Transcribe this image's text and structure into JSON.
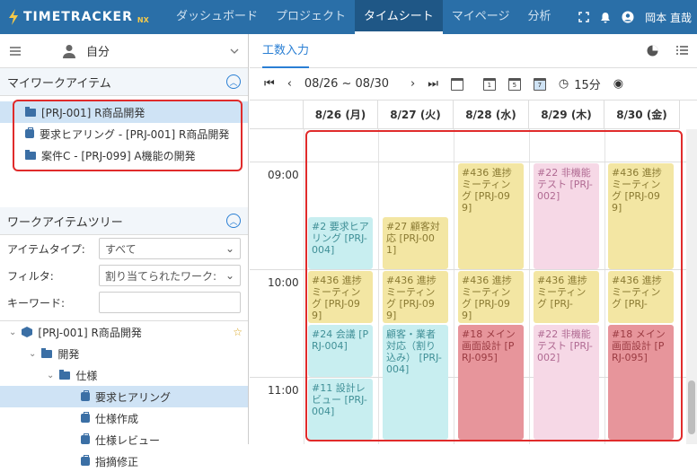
{
  "app": {
    "logo": "TIMETRACKER",
    "logo_suffix": "NX",
    "user": "岡本 直哉"
  },
  "nav": [
    {
      "label": "ダッシュボード"
    },
    {
      "label": "プロジェクト"
    },
    {
      "label": "タイムシート"
    },
    {
      "label": "マイページ"
    },
    {
      "label": "分析"
    }
  ],
  "left": {
    "who": "自分",
    "my_work_items_title": "マイワークアイテム",
    "my_work_items": [
      {
        "label": "[PRJ-001] R商品開発"
      },
      {
        "label": "要求ヒアリング - [PRJ-001] R商品開発"
      },
      {
        "label": "案件C - [PRJ-099] A機能の開発"
      }
    ],
    "tree_title": "ワークアイテムツリー",
    "item_type_label": "アイテムタイプ:",
    "item_type_value": "すべて",
    "filter_label": "フィルタ:",
    "filter_value": "割り当てられたワーク:",
    "keyword_label": "キーワード:",
    "keyword_value": "",
    "tree": [
      {
        "label": "[PRJ-001] R商品開発"
      },
      {
        "label": "開発"
      },
      {
        "label": "仕様"
      },
      {
        "label": "要求ヒアリング"
      },
      {
        "label": "仕様作成"
      },
      {
        "label": "仕様レビュー"
      },
      {
        "label": "指摘修正"
      }
    ]
  },
  "right": {
    "tab": "工数入力",
    "date_range": "08/26 ~ 08/30",
    "interval": "15分",
    "days": [
      "8/26 (月)",
      "8/27 (火)",
      "8/28 (水)",
      "8/29 (木)",
      "8/30 (金)"
    ],
    "times": [
      "09:00",
      "10:00",
      "11:00"
    ],
    "events": [
      {
        "text": "#436 進捗ミーティング [PRJ-099]",
        "color": "yellow"
      },
      {
        "text": "#22 非機能テスト [PRJ-002]",
        "color": "pink"
      },
      {
        "text": "#436 進捗ミーティング [PRJ-099]",
        "color": "yellow"
      },
      {
        "text": "#2 要求ヒアリング [PRJ-004]",
        "color": "cyan"
      },
      {
        "text": "#27 顧客対応 [PRJ-001]",
        "color": "yellow"
      },
      {
        "text": "#436 進捗ミーティング [PRJ-099]",
        "color": "yellow"
      },
      {
        "text": "#436 進捗ミーティング [PRJ-099]",
        "color": "yellow"
      },
      {
        "text": "#436 進捗ミーティング [PRJ-099]",
        "color": "yellow"
      },
      {
        "text": "#436 進捗ミーティング [PRJ-",
        "color": "yellow"
      },
      {
        "text": "#436 進捗ミーティング [PRJ-",
        "color": "yellow"
      },
      {
        "text": "#24 会議 [PRJ-004]",
        "color": "cyan"
      },
      {
        "text": "顧客・業者対応（割り込み） [PRJ-004]",
        "color": "cyan"
      },
      {
        "text": "#18 メイン画面設計 [PRJ-095]",
        "color": "red"
      },
      {
        "text": "#22 非機能テスト [PRJ-002]",
        "color": "pink"
      },
      {
        "text": "#18 メイン画面設計 [PRJ-095]",
        "color": "red"
      },
      {
        "text": "#11 設計レビュー [PRJ-004]",
        "color": "cyan"
      }
    ]
  },
  "colors": {
    "header": "#2a6fa8",
    "accent": "#2a7fd4",
    "highlight": "#e02b2b"
  }
}
